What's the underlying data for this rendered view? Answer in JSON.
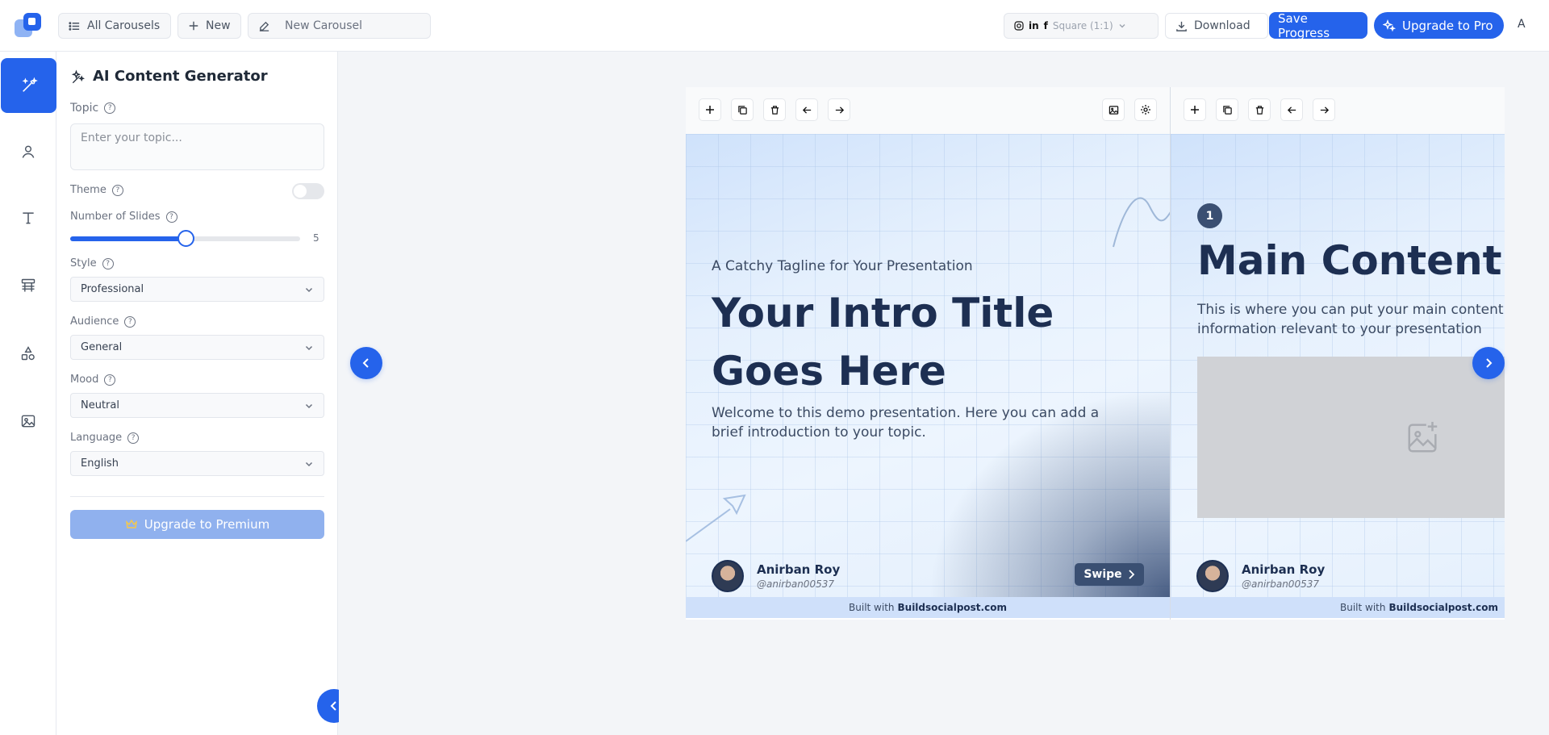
{
  "topbar": {
    "all_carousels": "All Carousels",
    "new": "New",
    "carousel_name_placeholder": "New Carousel",
    "format_selector": "Square (1:1)",
    "download": "Download",
    "save_progress": "Save Progress",
    "upgrade": "Upgrade to Pro",
    "user_initial": "A"
  },
  "sidebar": {
    "title": "AI Content Generator",
    "topic_label": "Topic",
    "topic_placeholder": "Enter your topic...",
    "theme_label": "Theme",
    "slides_label": "Number of Slides",
    "slides_value": "5",
    "slides_fraction": 0.5,
    "style_label": "Style",
    "style_value": "Professional",
    "audience_label": "Audience",
    "audience_value": "General",
    "mood_label": "Mood",
    "mood_value": "Neutral",
    "language_label": "Language",
    "language_value": "English",
    "upgrade_premium": "Upgrade to Premium"
  },
  "slides": [
    {
      "tagline": "A Catchy Tagline for Your Presentation",
      "title": "Your Intro Title Goes Here",
      "body": "Welcome to this demo presentation. Here you can add a brief introduction to your topic.",
      "author_name": "Anirban Roy",
      "author_handle": "@anirban00537",
      "swipe": "Swipe",
      "footer_prefix": "Built with",
      "footer_brand": "Buildsocialpost.com"
    },
    {
      "number": "1",
      "title": "Main Content Sl",
      "body": "This is where you can put your main content. Ad or any information relevant to your presentation",
      "author_name": "Anirban Roy",
      "author_handle": "@anirban00537",
      "footer_prefix": "Built with",
      "footer_brand": "Buildsocialpost.com"
    }
  ],
  "colors": {
    "accent": "#2563eb",
    "dark_navy": "#1d2f52",
    "panel_bg": "#ffffff"
  }
}
